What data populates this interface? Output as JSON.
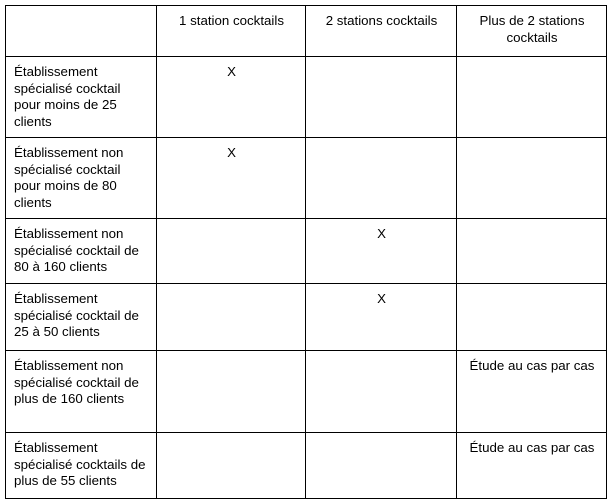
{
  "table": {
    "headers": [
      "",
      "1 station cocktails",
      "2 stations cocktails",
      "Plus de 2 stations cocktails"
    ],
    "rows": [
      {
        "label": "Établissement spécialisé cocktail pour moins de 25 clients",
        "cells": [
          "X",
          "",
          ""
        ]
      },
      {
        "label": "Établissement non spécialisé cocktail pour moins de 80 clients",
        "cells": [
          "X",
          "",
          ""
        ]
      },
      {
        "label": "Établissement non spécialisé cocktail de 80 à 160 clients",
        "cells": [
          "",
          "X",
          ""
        ]
      },
      {
        "label": "Établissement spécialisé cocktail de 25 à 50 clients",
        "cells": [
          "",
          "X",
          ""
        ]
      },
      {
        "label": "Établissement non spécialisé cocktail de plus de 160 clients",
        "cells": [
          "",
          "",
          "Étude au cas par cas"
        ]
      },
      {
        "label": "Établissement spécialisé cocktails de plus de 55 clients",
        "cells": [
          "",
          "",
          "Étude au cas par cas"
        ]
      }
    ]
  }
}
